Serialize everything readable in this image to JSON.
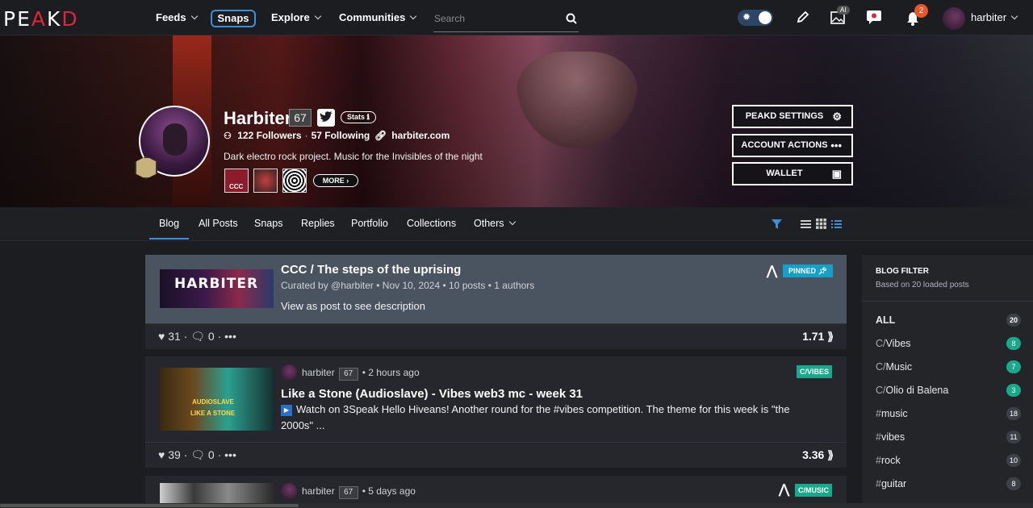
{
  "nav": {
    "logo_left": "PE",
    "logo_mid": "A",
    "logo_right": "K",
    "logo_end": "D",
    "items": [
      "Feeds",
      "Snaps",
      "Explore",
      "Communities"
    ],
    "search_placeholder": "Search",
    "ai_badge": "AI",
    "notif_count": "2",
    "username": "harbiter"
  },
  "profile": {
    "name": "Harbiter",
    "reputation": "67",
    "stats_label": "Stats",
    "followers": "122 Followers",
    "following": "57 Following",
    "website": "harbiter.com",
    "bio": "Dark electro rock project. Music for the Invisibles of the night",
    "more_label": "MORE",
    "community_ccc": "CCC"
  },
  "cover_buttons": {
    "settings": "PEAKD SETTINGS",
    "account": "ACCOUNT ACTIONS",
    "wallet": "WALLET"
  },
  "tabs": [
    "Blog",
    "All Posts",
    "Snaps",
    "Replies",
    "Portfolio",
    "Collections",
    "Others"
  ],
  "posts": [
    {
      "thumb_text": "HARBITER",
      "title": "CCC / The steps of the uprising",
      "meta": "Curated by @harbiter  •  Nov 10, 2024  •  10 posts  •  1 authors",
      "desc": "View as post to see description",
      "tag": "PINNED",
      "likes": "31",
      "comments": "0",
      "payout": "1.71"
    },
    {
      "thumb_text_1": "AUDIOSLAVE",
      "thumb_text_2": "LIKE A STONE",
      "author": "harbiter",
      "rep": "67",
      "time": "2 hours ago",
      "tag": "C/VIBES",
      "title": "Like a Stone (Audioslave) - Vibes web3 mc - week 31",
      "desc": "Watch on 3Speak Hello Hiveans! Another round for the #vibes competition. The theme for this week is \"the 2000s\" ...",
      "likes": "39",
      "comments": "0",
      "payout": "3.36"
    },
    {
      "author": "harbiter",
      "rep": "67",
      "time": "5 days ago",
      "tag": "C/MUSIC"
    }
  ],
  "sidebar": {
    "title": "BLOG FILTER",
    "subtitle": "Based on 20 loaded posts",
    "rows": [
      {
        "prefix": "",
        "label": "ALL",
        "count": "20"
      },
      {
        "prefix": "C/",
        "label": "Vibes",
        "count": "8"
      },
      {
        "prefix": "C/",
        "label": "Music",
        "count": "7"
      },
      {
        "prefix": "C/",
        "label": "Olio di Balena",
        "count": "3"
      },
      {
        "prefix": "#",
        "label": "music",
        "count": "18"
      },
      {
        "prefix": "#",
        "label": "vibes",
        "count": "11"
      },
      {
        "prefix": "#",
        "label": "rock",
        "count": "10"
      },
      {
        "prefix": "#",
        "label": "guitar",
        "count": "8"
      }
    ]
  },
  "colors": {
    "accent": "#3c8fd8",
    "teal": "#18a88c",
    "pinned": "#14a0c8",
    "brand_red": "#e0243b",
    "notif": "#e8562a"
  }
}
